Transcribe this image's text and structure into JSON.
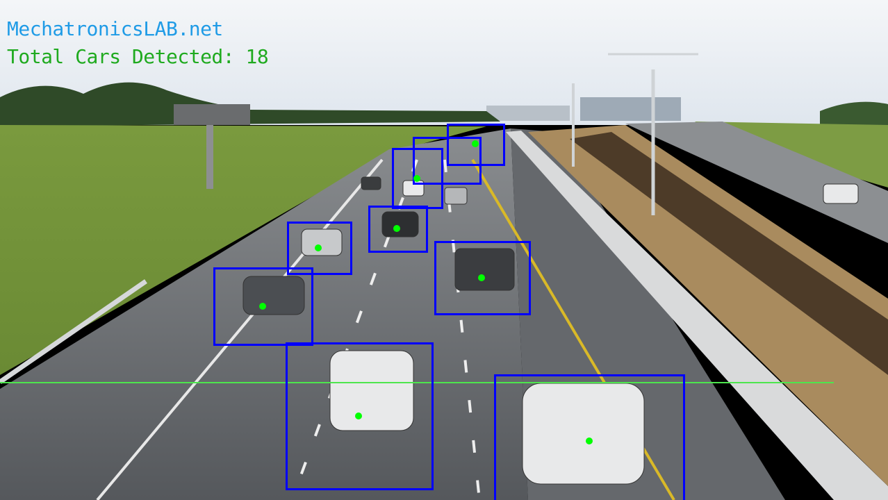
{
  "overlay": {
    "brand_text": "MechatronicsLAB.net",
    "count_label": "Total Cars Detected: 18"
  },
  "colors": {
    "brand": "#1f9be6",
    "count_text": "#1faa1f",
    "bbox": "#0000ff",
    "centroid": "#00ff00",
    "counting_line": "#4de64d"
  }
}
